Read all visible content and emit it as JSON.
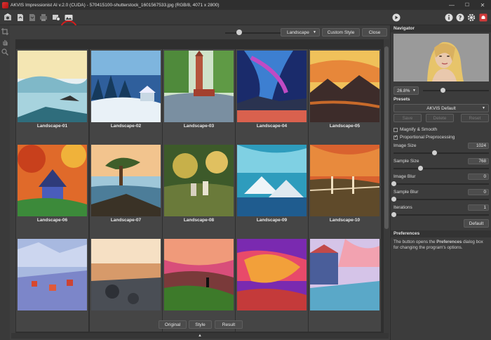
{
  "window": {
    "title": "AKVIS Impressionist AI v.2.0 (CUDA) - 570415100-shutterstock_1601567533.jpg (RGB/8, 4071 x 2800)",
    "minimize": "—",
    "maximize": "☐",
    "close": "✕"
  },
  "toolbar": {
    "icons": [
      "home-icon",
      "open-file-icon",
      "save-file-icon",
      "print-icon",
      "batch-icon",
      "presets-gallery-icon"
    ],
    "right_icons": [
      "run-icon",
      "about-icon",
      "help-icon",
      "settings-icon",
      "notifications-icon"
    ]
  },
  "gallery": {
    "category_select": "Landscape",
    "custom_style_label": "Custom Style",
    "close_label": "Close",
    "items": [
      "Landscape-01",
      "Landscape-02",
      "Landscape-03",
      "Landscape-04",
      "Landscape-05",
      "Landscape-06",
      "Landscape-07",
      "Landscape-08",
      "Landscape-09",
      "Landscape-10",
      "",
      "",
      "",
      "",
      ""
    ],
    "view_buttons": [
      "Original",
      "Style",
      "Result"
    ],
    "collapse": "▲"
  },
  "navigator": {
    "header": "Navigator",
    "zoom": "26.8%"
  },
  "presets": {
    "header": "Presets",
    "selected": "AKVIS Default",
    "save": "Save",
    "delete": "Delete",
    "reset": "Reset"
  },
  "settings": {
    "magnify_smooth": "Magnify & Smooth",
    "proportional": "Proportional Preprocessing",
    "params": [
      {
        "label": "Image Size",
        "value": "1024"
      },
      {
        "label": "Sample Size",
        "value": "768"
      },
      {
        "label": "Image Blur",
        "value": "0"
      },
      {
        "label": "Sample Blur",
        "value": "0"
      },
      {
        "label": "Iterations",
        "value": "1"
      }
    ],
    "default_label": "Default"
  },
  "preferences": {
    "header": "Preferences",
    "text_before": "The button opens the ",
    "bold": "Preferences",
    "text_after": " dialog box for changing the program's options."
  },
  "colors": {
    "highlight": "#d41c1c",
    "run_red": "#d03a3a"
  }
}
